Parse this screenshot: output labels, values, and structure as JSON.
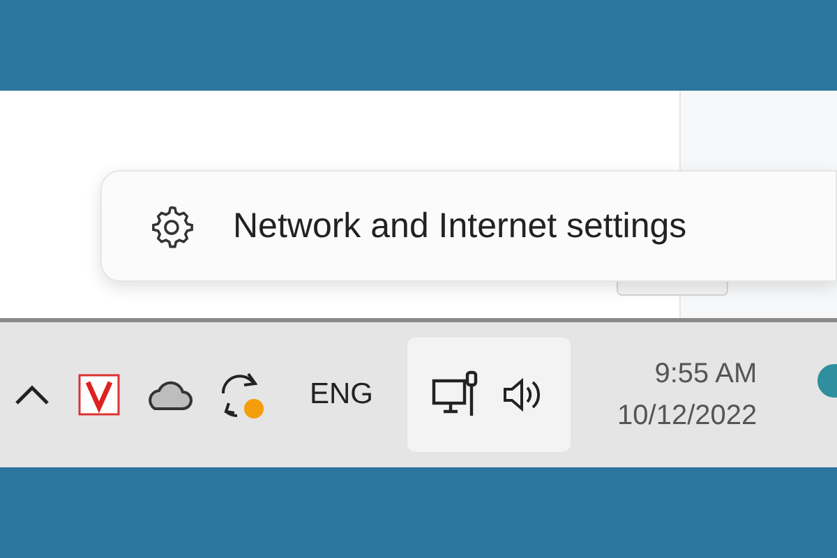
{
  "context_menu": {
    "items": [
      {
        "label": "Network and Internet settings"
      }
    ]
  },
  "taskbar": {
    "language": "ENG",
    "clock": {
      "time": "9:55 AM",
      "date": "10/12/2022"
    }
  }
}
